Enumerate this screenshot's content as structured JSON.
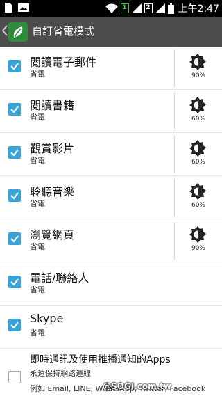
{
  "status_bar": {
    "sim1": "1",
    "sim2": "2",
    "time": "上午2:47"
  },
  "action_bar": {
    "title": "自訂省電模式"
  },
  "items": [
    {
      "title": "閱讀電子郵件",
      "subtitle": "省電",
      "checked": true,
      "brightness": "90%"
    },
    {
      "title": "閱讀書籍",
      "subtitle": "省電",
      "checked": true,
      "brightness": "60%"
    },
    {
      "title": "觀賞影片",
      "subtitle": "省電",
      "checked": true,
      "brightness": "60%"
    },
    {
      "title": "聆聽音樂",
      "subtitle": "省電",
      "checked": true,
      "brightness": "60%"
    },
    {
      "title": "瀏覽網頁",
      "subtitle": "省電",
      "checked": true,
      "brightness": "90%"
    },
    {
      "title": "電話/聯絡人",
      "subtitle": "省電",
      "checked": true
    },
    {
      "title": "Skype",
      "subtitle": "省電",
      "checked": true
    }
  ],
  "last_item": {
    "title": "即時通訊及使用推播通知的Apps",
    "subtitle": "永遠保持網路連線",
    "detail": "例如 Email, LINE, WhatsApp, Twitter, Facebook",
    "checked": false
  },
  "watermark": "@SOGI.com.tw",
  "colors": {
    "checkbox": "#37a4d9",
    "action_bar": "#4c4c4c",
    "app_icon": "#2d8b3a"
  }
}
